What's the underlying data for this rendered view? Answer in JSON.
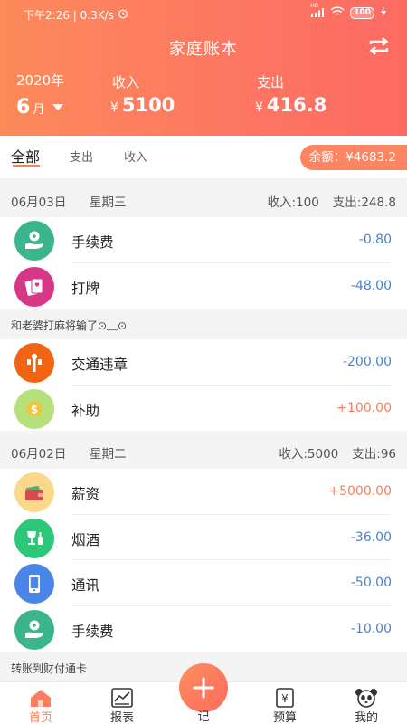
{
  "status": {
    "left": "下午2:26 | 0.3K/s",
    "hd": "HD",
    "battery": "100"
  },
  "header": {
    "title": "家庭账本",
    "year": "2020年",
    "month": "6",
    "month_unit": "月",
    "income_label": "收入",
    "income_currency": "¥",
    "income_value": "5100",
    "expense_label": "支出",
    "expense_currency": "¥",
    "expense_value": "416.8"
  },
  "tabs": [
    "全部",
    "支出",
    "收入"
  ],
  "balance": "余额：¥4683.2",
  "days": [
    {
      "date": "06月03日",
      "weekday": "星期三",
      "income": "收入:100",
      "expense": "支出:248.8",
      "records": [
        {
          "name": "手续费",
          "amount": "-0.80",
          "icon": "fee-hand-coin-icon"
        },
        {
          "name": "打牌",
          "amount": "-48.00",
          "icon": "playing-cards-icon",
          "note": "和老婆打麻将输了⊙﹏⊙"
        },
        {
          "name": "交通违章",
          "amount": "-200.00",
          "icon": "traffic-light-icon"
        },
        {
          "name": "补助",
          "amount": "+100.00",
          "icon": "dollar-coin-icon"
        }
      ]
    },
    {
      "date": "06月02日",
      "weekday": "星期二",
      "income": "收入:5000",
      "expense": "支出:96",
      "records": [
        {
          "name": "薪资",
          "amount": "+5000.00",
          "icon": "wallet-icon"
        },
        {
          "name": "烟酒",
          "amount": "-36.00",
          "icon": "wine-glass-icon"
        },
        {
          "name": "通讯",
          "amount": "-50.00",
          "icon": "phone-icon"
        },
        {
          "name": "手续费",
          "amount": "-10.00",
          "icon": "fee-hand-coin-icon",
          "note": "转账到财付通卡"
        }
      ]
    }
  ],
  "tabbar": {
    "home": "首页",
    "report": "报表",
    "record": "记",
    "budget": "预算",
    "mine": "我的"
  },
  "colors": {
    "accent": "#fd7d5e",
    "expense": "#4d82c9",
    "income": "#f3805a"
  }
}
